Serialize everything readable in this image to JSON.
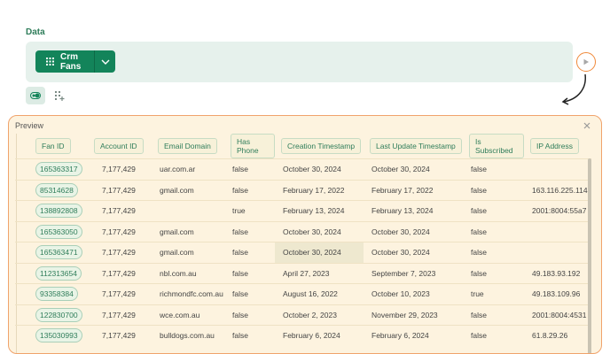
{
  "section_label": "Data",
  "source_button": {
    "label": "Crm Fans"
  },
  "preview": {
    "title": "Preview",
    "columns": [
      "Fan ID",
      "Account ID",
      "Email Domain",
      "Has Phone",
      "Creation Timestamp",
      "Last Update Timestamp",
      "Is Subscribed",
      "IP Address"
    ],
    "rows": [
      [
        "165363317",
        "7,177,429",
        "uar.com.ar",
        "false",
        "October 30, 2024",
        "October 30, 2024",
        "false",
        ""
      ],
      [
        "85314628",
        "7,177,429",
        "gmail.com",
        "false",
        "February 17, 2022",
        "February 17, 2022",
        "false",
        "163.116.225.114"
      ],
      [
        "138892808",
        "7,177,429",
        "",
        "true",
        "February 13, 2024",
        "February 13, 2024",
        "false",
        "2001:8004:55a7"
      ],
      [
        "165363050",
        "7,177,429",
        "gmail.com",
        "false",
        "October 30, 2024",
        "October 30, 2024",
        "false",
        ""
      ],
      [
        "165363471",
        "7,177,429",
        "gmail.com",
        "false",
        "October 30, 2024",
        "October 30, 2024",
        "false",
        ""
      ],
      [
        "112313654",
        "7,177,429",
        "nbl.com.au",
        "false",
        "April 27, 2023",
        "September 7, 2023",
        "false",
        "49.183.93.192"
      ],
      [
        "93358384",
        "7,177,429",
        "richmondfc.com.au",
        "false",
        "August 16, 2022",
        "October 10, 2023",
        "true",
        "49.183.109.96"
      ],
      [
        "122830700",
        "7,177,429",
        "wce.com.au",
        "false",
        "October 2, 2023",
        "November 29, 2023",
        "false",
        "2001:8004:4531"
      ],
      [
        "135030993",
        "7,177,429",
        "bulldogs.com.au",
        "false",
        "February 6, 2024",
        "February 6, 2024",
        "false",
        "61.8.29.26"
      ]
    ]
  },
  "icons": [
    "grid-icon",
    "chevron-down-icon",
    "play-icon",
    "curved-arrow-icon",
    "toggle-icon",
    "grid-settings-icon",
    "close-icon"
  ],
  "colors": {
    "accent_green": "#13845a",
    "accent_orange": "#f0893a",
    "preview_bg": "#fdf3df"
  }
}
